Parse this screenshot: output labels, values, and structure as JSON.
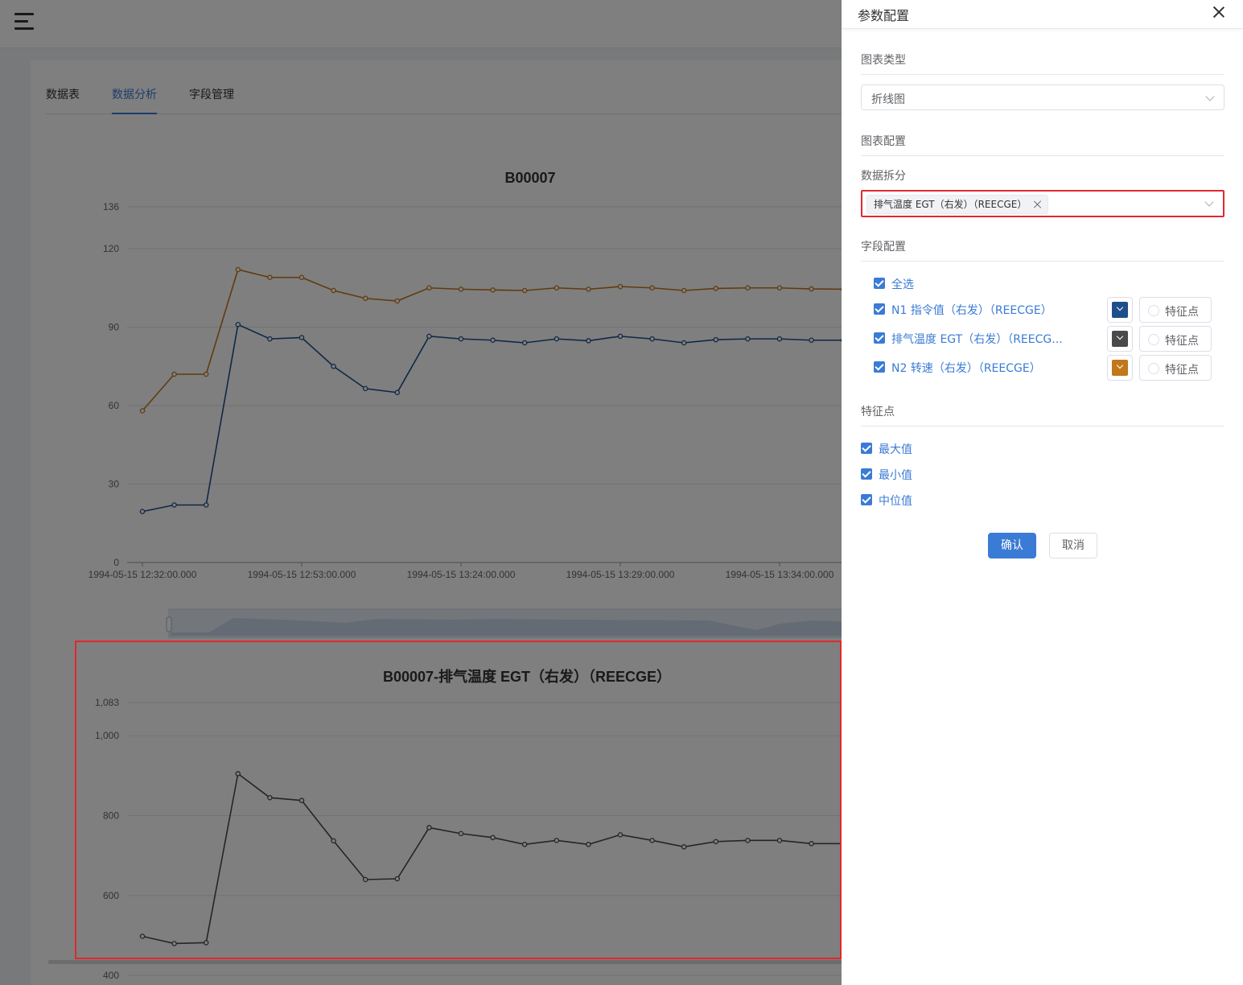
{
  "nav": {
    "tabs": [
      {
        "label": "数据表"
      },
      {
        "label": "数据分析"
      },
      {
        "label": "字段管理"
      }
    ]
  },
  "colors": {
    "accent": "#3a7bd5",
    "highlight": "#e0282e",
    "series_n1": "#1f4e8c",
    "series_egt": "#4a4a4a",
    "series_n2": "#c1771a"
  },
  "chart_data": [
    {
      "type": "line",
      "title": "B00007",
      "ylim": [
        0,
        136
      ],
      "yticks": [
        0,
        30,
        60,
        90,
        120,
        136
      ],
      "xtick_labels": [
        "1994-05-15 12:32:00.000",
        "1994-05-15 12:53:00.000",
        "1994-05-15 13:24:00.000",
        "1994-05-15 13:29:00.000",
        "1994-05-15 13:34:00.000"
      ],
      "series": [
        {
          "color": "#c1771a",
          "values": [
            58,
            72,
            72,
            112,
            109,
            109,
            104,
            101,
            100,
            105,
            104.5,
            104.2,
            104,
            105,
            104.5,
            105.5,
            105,
            104,
            104.8,
            105,
            105,
            104.6,
            104.5
          ]
        },
        {
          "color": "#1f4e8c",
          "values": [
            19.5,
            22,
            22,
            91,
            85.5,
            86,
            75,
            66.5,
            65,
            86.5,
            85.5,
            85,
            84,
            85.5,
            84.8,
            86.5,
            85.5,
            84,
            85.2,
            85.5,
            85.5,
            85,
            85
          ]
        }
      ]
    },
    {
      "type": "line",
      "title": "B00007-排气温度 EGT（右发）（REECGE）",
      "ylim": [
        350,
        1083
      ],
      "yticks": [
        400,
        600,
        800,
        1000,
        1083
      ],
      "ytick_labels": [
        "400",
        "600",
        "800",
        "1,000",
        "1,083"
      ],
      "series": [
        {
          "color": "#4a4a4a",
          "values": [
            498,
            480,
            482,
            905,
            845,
            838,
            737,
            640,
            642,
            770,
            755,
            745,
            728,
            738,
            728,
            752,
            738,
            722,
            735,
            738,
            738,
            730,
            730
          ]
        }
      ]
    }
  ],
  "drawer": {
    "title": "参数配置",
    "chart_type_section": "图表类型",
    "chart_type_value": "折线图",
    "chart_config_section": "图表配置",
    "data_split_label": "数据拆分",
    "data_split_tag": "排气温度 EGT（右发）（REECGE）",
    "field_config_section": "字段配置",
    "select_all": "全选",
    "fields": [
      {
        "label": "N1 指令值（右发）（REECGE）",
        "color": "#1f4e8c",
        "feature_label": "特征点"
      },
      {
        "label": "排气温度 EGT（右发）（REECG...",
        "color": "#4a4a4a",
        "feature_label": "特征点"
      },
      {
        "label": "N2 转速（右发）（REECGE）",
        "color": "#c1771a",
        "feature_label": "特征点"
      }
    ],
    "feature_section": "特征点",
    "features": [
      {
        "label": "最大值"
      },
      {
        "label": "最小值"
      },
      {
        "label": "中位值"
      }
    ],
    "confirm_label": "确认",
    "cancel_label": "取消"
  }
}
